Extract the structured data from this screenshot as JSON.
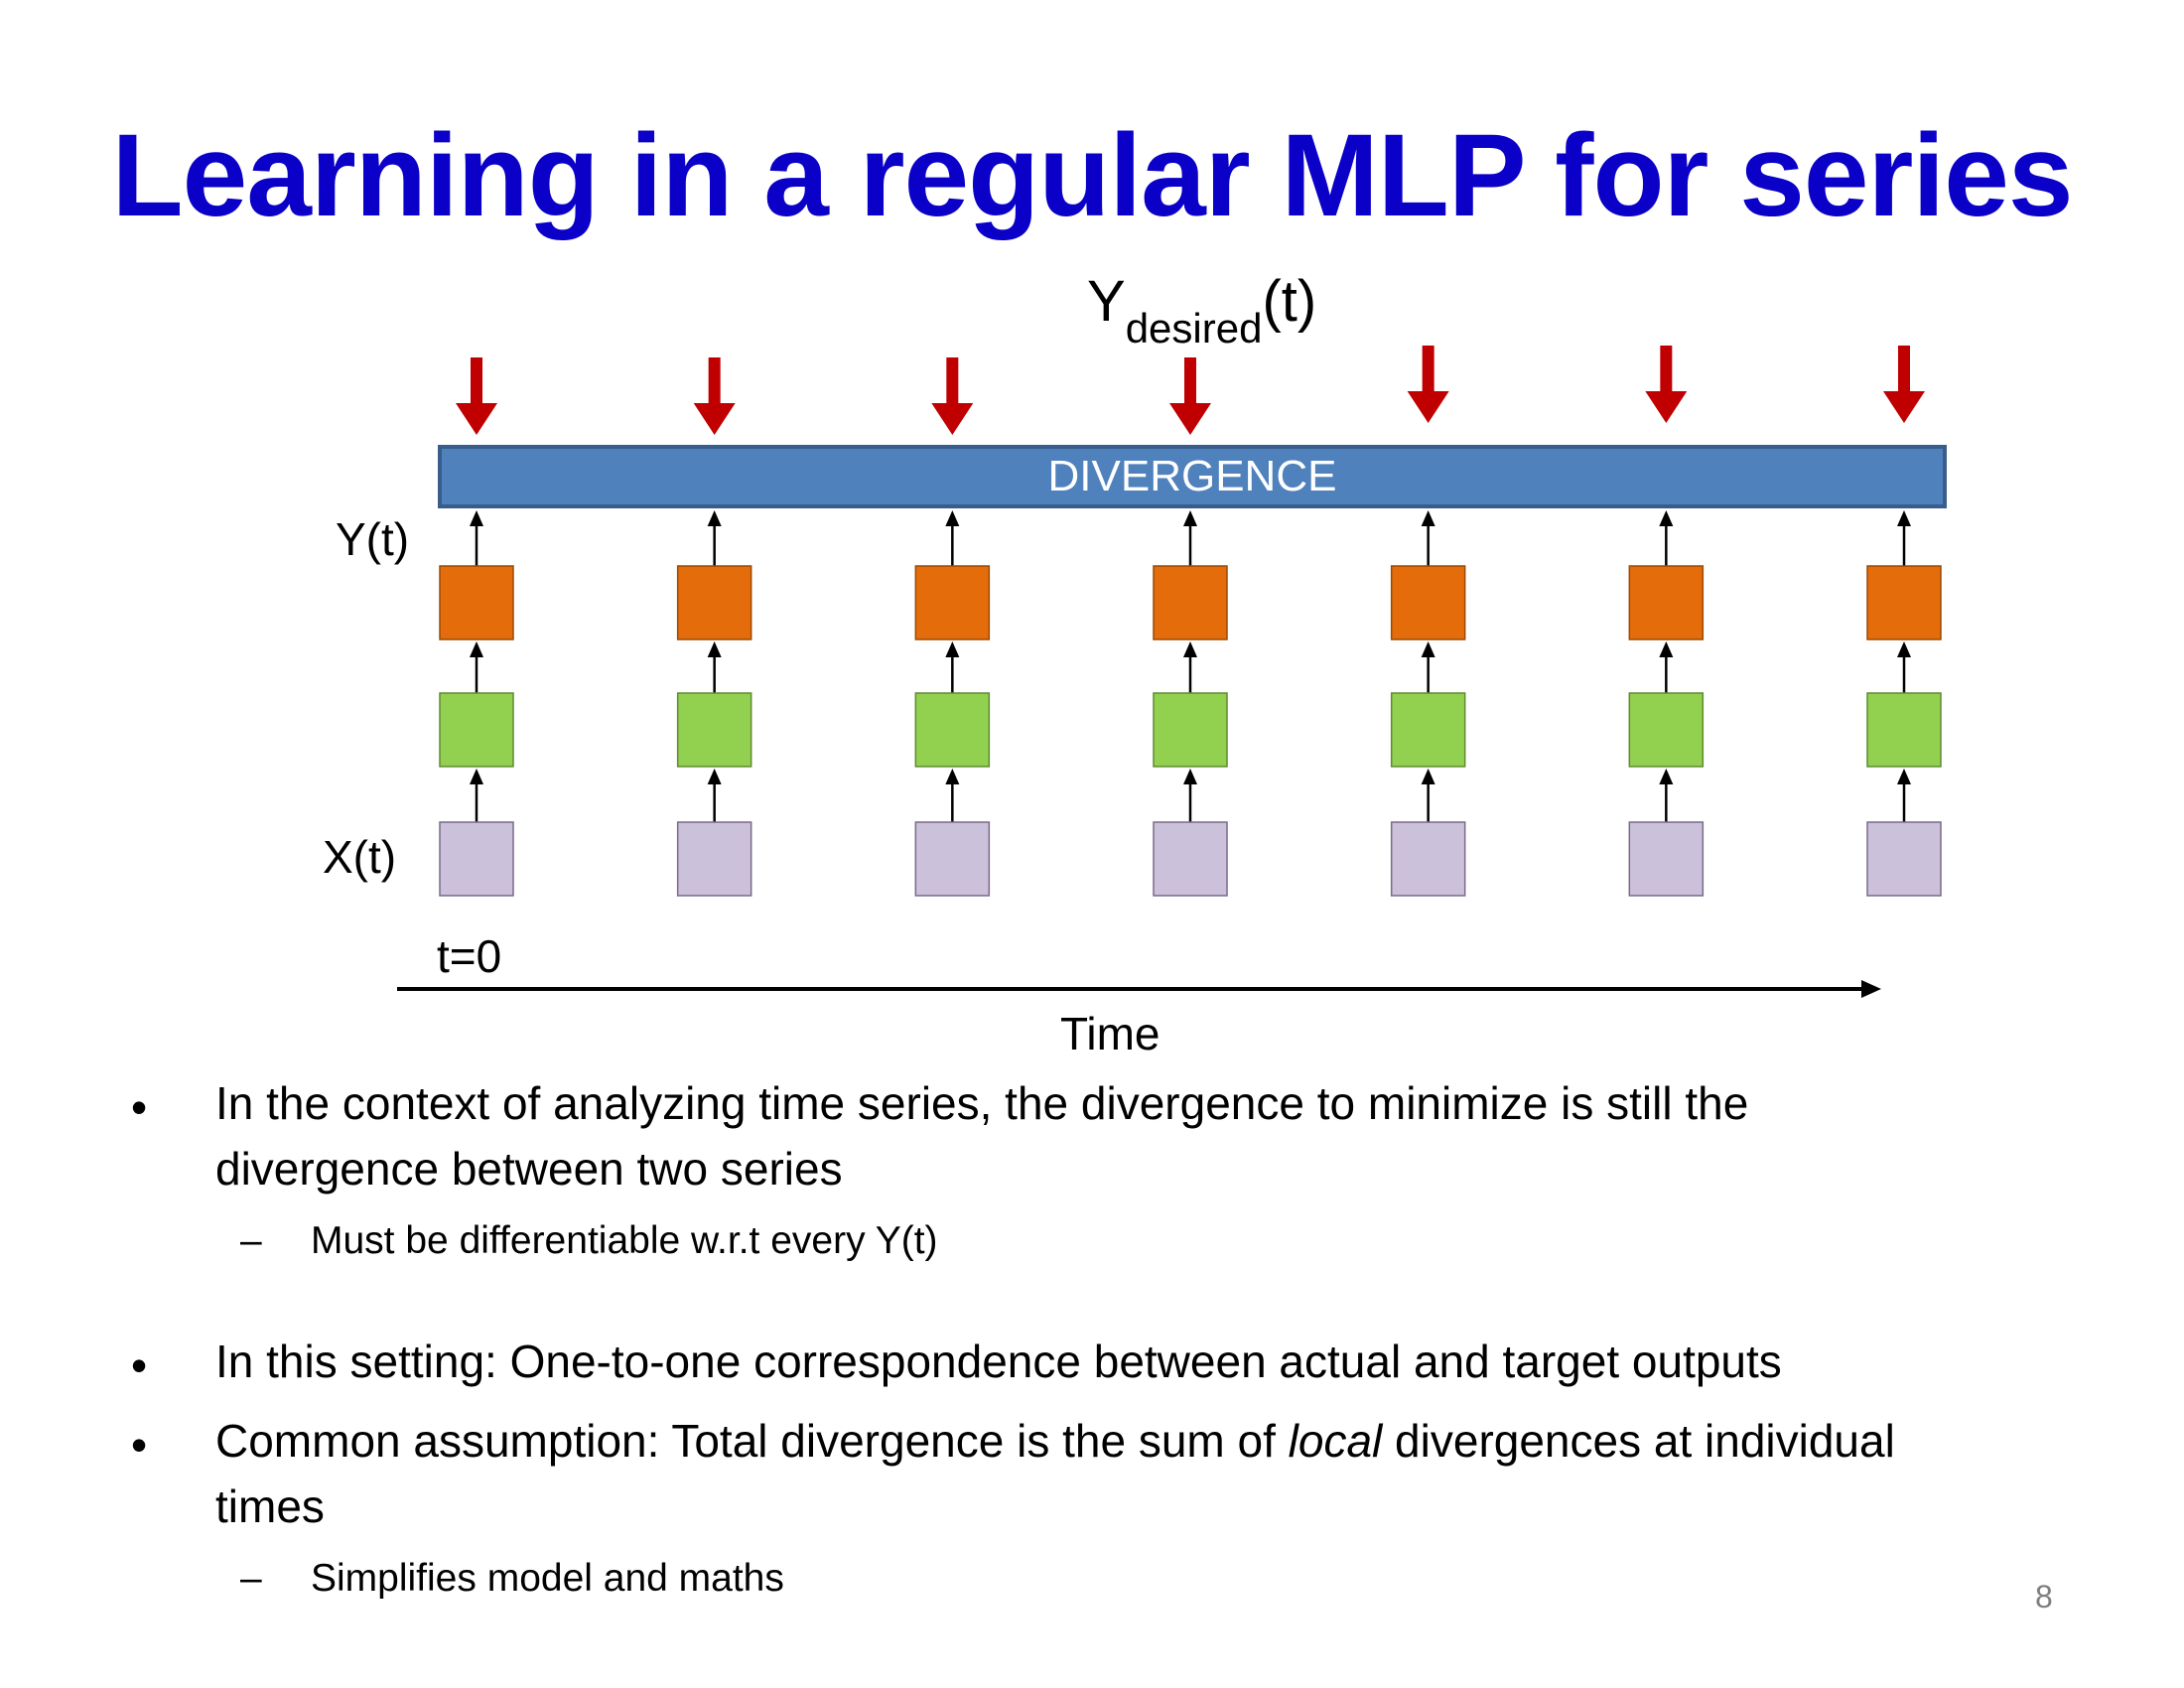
{
  "title": "Learning in a regular MLP for series",
  "diagram": {
    "y_desired_main": "Y",
    "y_desired_sub": "desired",
    "y_desired_tail": "(t)",
    "divergence_label": "DIVERGENCE",
    "y_label": "Y(t)",
    "x_label": "X(t)",
    "t0_label": "t=0",
    "time_label": "Time",
    "timesteps": 7,
    "colors": {
      "target_arrow": "#c00000",
      "divergence_fill": "#4f81bd",
      "output_node": "#e46c0a",
      "hidden_node": "#92d050",
      "input_node": "#ccc1da"
    }
  },
  "bullets": {
    "b1": "In the context of analyzing time series, the divergence to minimize is still the",
    "b1_cont": "divergence between two series",
    "b1_sub": "Must be differentiable w.r.t every Y(t)",
    "b2": "In this setting: One-to-one correspondence between actual and target outputs",
    "b3_pre": "Common assumption: Total divergence is the sum of ",
    "b3_em": "local",
    "b3_post": " divergences at individual",
    "b3_cont": "times",
    "b3_sub": "Simplifies model and maths"
  },
  "page_number": "8"
}
